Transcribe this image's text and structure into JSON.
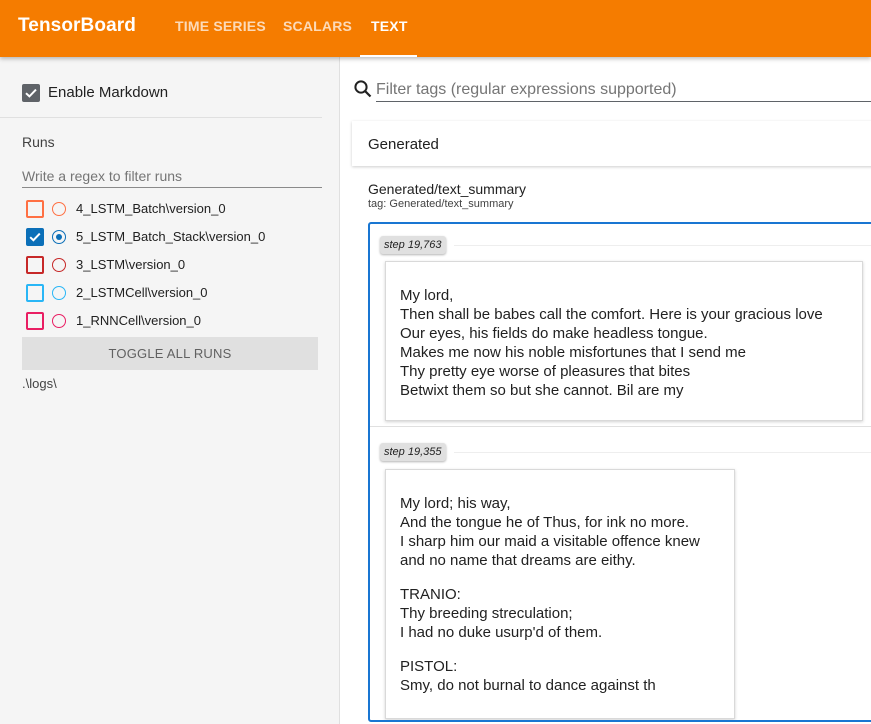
{
  "app": {
    "title": "TensorBoard",
    "tabs": [
      {
        "label": "TIME SERIES"
      },
      {
        "label": "SCALARS"
      },
      {
        "label": "TEXT"
      }
    ]
  },
  "sidebar": {
    "markdown_label": "Enable Markdown",
    "markdown_enabled": true,
    "runs_title": "Runs",
    "runs_filter_placeholder": "Write a regex to filter runs",
    "runs": [
      {
        "label": "4_LSTM_Batch\\version_0",
        "color": "#ff7043",
        "checked": false,
        "selected": false
      },
      {
        "label": "5_LSTM_Batch_Stack\\version_0",
        "color": "#0b6fb8",
        "checked": true,
        "selected": true
      },
      {
        "label": "3_LSTM\\version_0",
        "color": "#c62828",
        "checked": false,
        "selected": false
      },
      {
        "label": "2_LSTMCell\\version_0",
        "color": "#29b6f6",
        "checked": false,
        "selected": false
      },
      {
        "label": "1_RNNCell\\version_0",
        "color": "#e91e63",
        "checked": false,
        "selected": false
      }
    ],
    "toggle_all_label": "TOGGLE ALL RUNS",
    "log_dir": ".\\logs\\"
  },
  "main": {
    "tag_filter_placeholder": "Filter tags (regular expressions supported)",
    "group_title": "Generated",
    "card": {
      "title": "Generated/text_summary",
      "tag_line": "tag: Generated/text_summary",
      "entries": [
        {
          "step": "step 19,763",
          "paragraphs": [
            "My lord,\nThen shall be babes call the comfort. Here is your gracious love\nOur eyes, his fields do make headless tongue.\nMakes me now his noble misfortunes that I send me\nThy pretty eye worse of pleasures that bites\nBetwixt them so but she cannot. Bil are my"
          ]
        },
        {
          "step": "step 19,355",
          "paragraphs": [
            "My lord; his way,\nAnd the tongue he of Thus, for ink no more.\nI sharp him our maid a visitable offence knew\nand no name that dreams are eithy.",
            "TRANIO:\nThy breeding streculation;\nI had no duke usurp'd of them.",
            "PISTOL:\nSmy, do not burnal to dance against th"
          ]
        }
      ]
    }
  }
}
